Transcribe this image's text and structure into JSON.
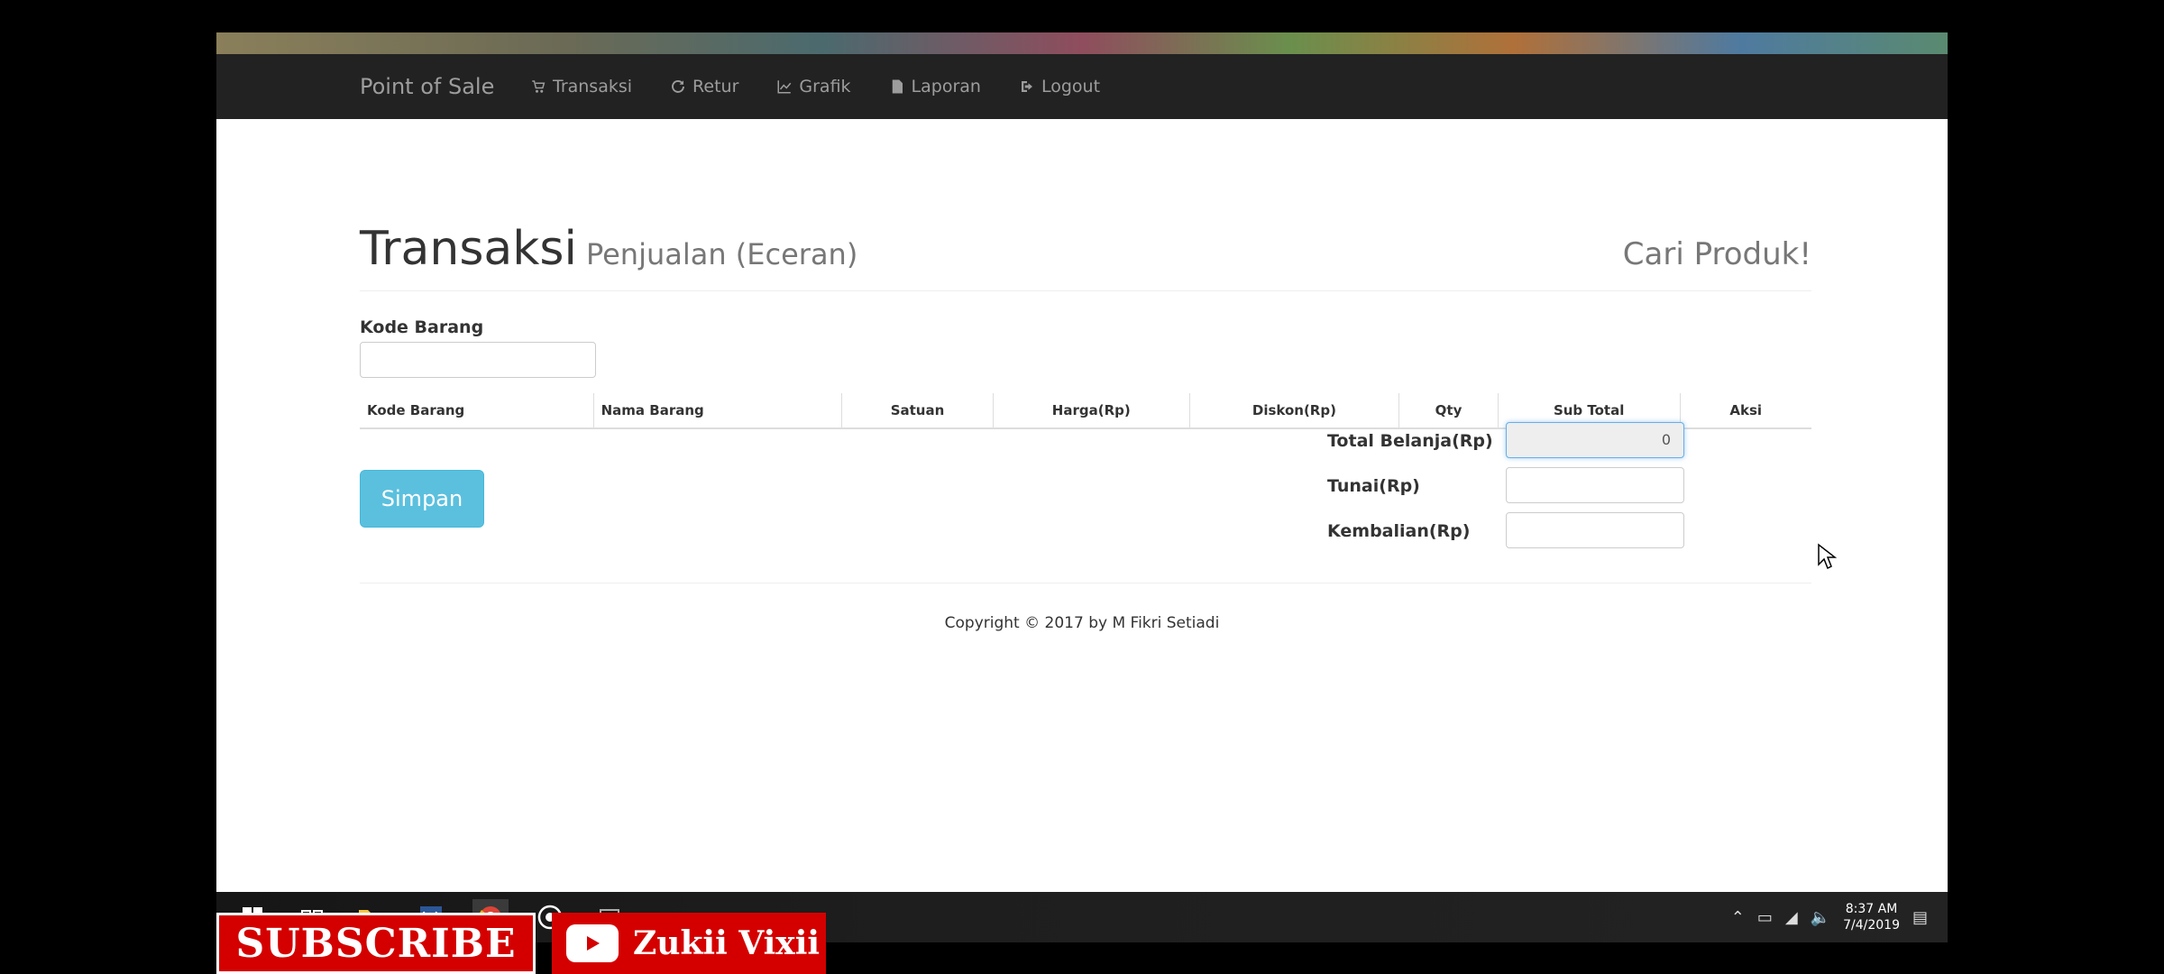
{
  "navbar": {
    "brand": "Point of Sale",
    "items": [
      {
        "label": "Transaksi",
        "icon": "cart-icon"
      },
      {
        "label": "Retur",
        "icon": "refresh-icon"
      },
      {
        "label": "Grafik",
        "icon": "line-chart-icon"
      },
      {
        "label": "Laporan",
        "icon": "file-icon"
      },
      {
        "label": "Logout",
        "icon": "logout-icon"
      }
    ]
  },
  "header": {
    "title": "Transaksi",
    "subtitle": "Penjualan (Eceran)",
    "search_link": "Cari Produk!"
  },
  "form": {
    "kode_label": "Kode Barang",
    "kode_value": ""
  },
  "table": {
    "columns": [
      "Kode Barang",
      "Nama Barang",
      "Satuan",
      "Harga(Rp)",
      "Diskon(Rp)",
      "Qty",
      "Sub Total",
      "Aksi"
    ],
    "rows": []
  },
  "actions": {
    "save_label": "Simpan"
  },
  "summary": {
    "total_label": "Total Belanja(Rp)",
    "total_value": "0",
    "tunai_label": "Tunai(Rp)",
    "tunai_value": "",
    "kembalian_label": "Kembalian(Rp)",
    "kembalian_value": ""
  },
  "footer": {
    "copyright": "Copyright © 2017 by M Fikri Setiadi"
  },
  "taskbar": {
    "time": "8:37 AM",
    "date": "7/4/2019"
  },
  "overlay": {
    "subscribe": "SUBSCRIBE",
    "channel": "Zukii Vixii"
  },
  "colors": {
    "navbar_bg": "#222222",
    "button_info": "#5bc0de",
    "subscribe_red": "#d40000"
  }
}
